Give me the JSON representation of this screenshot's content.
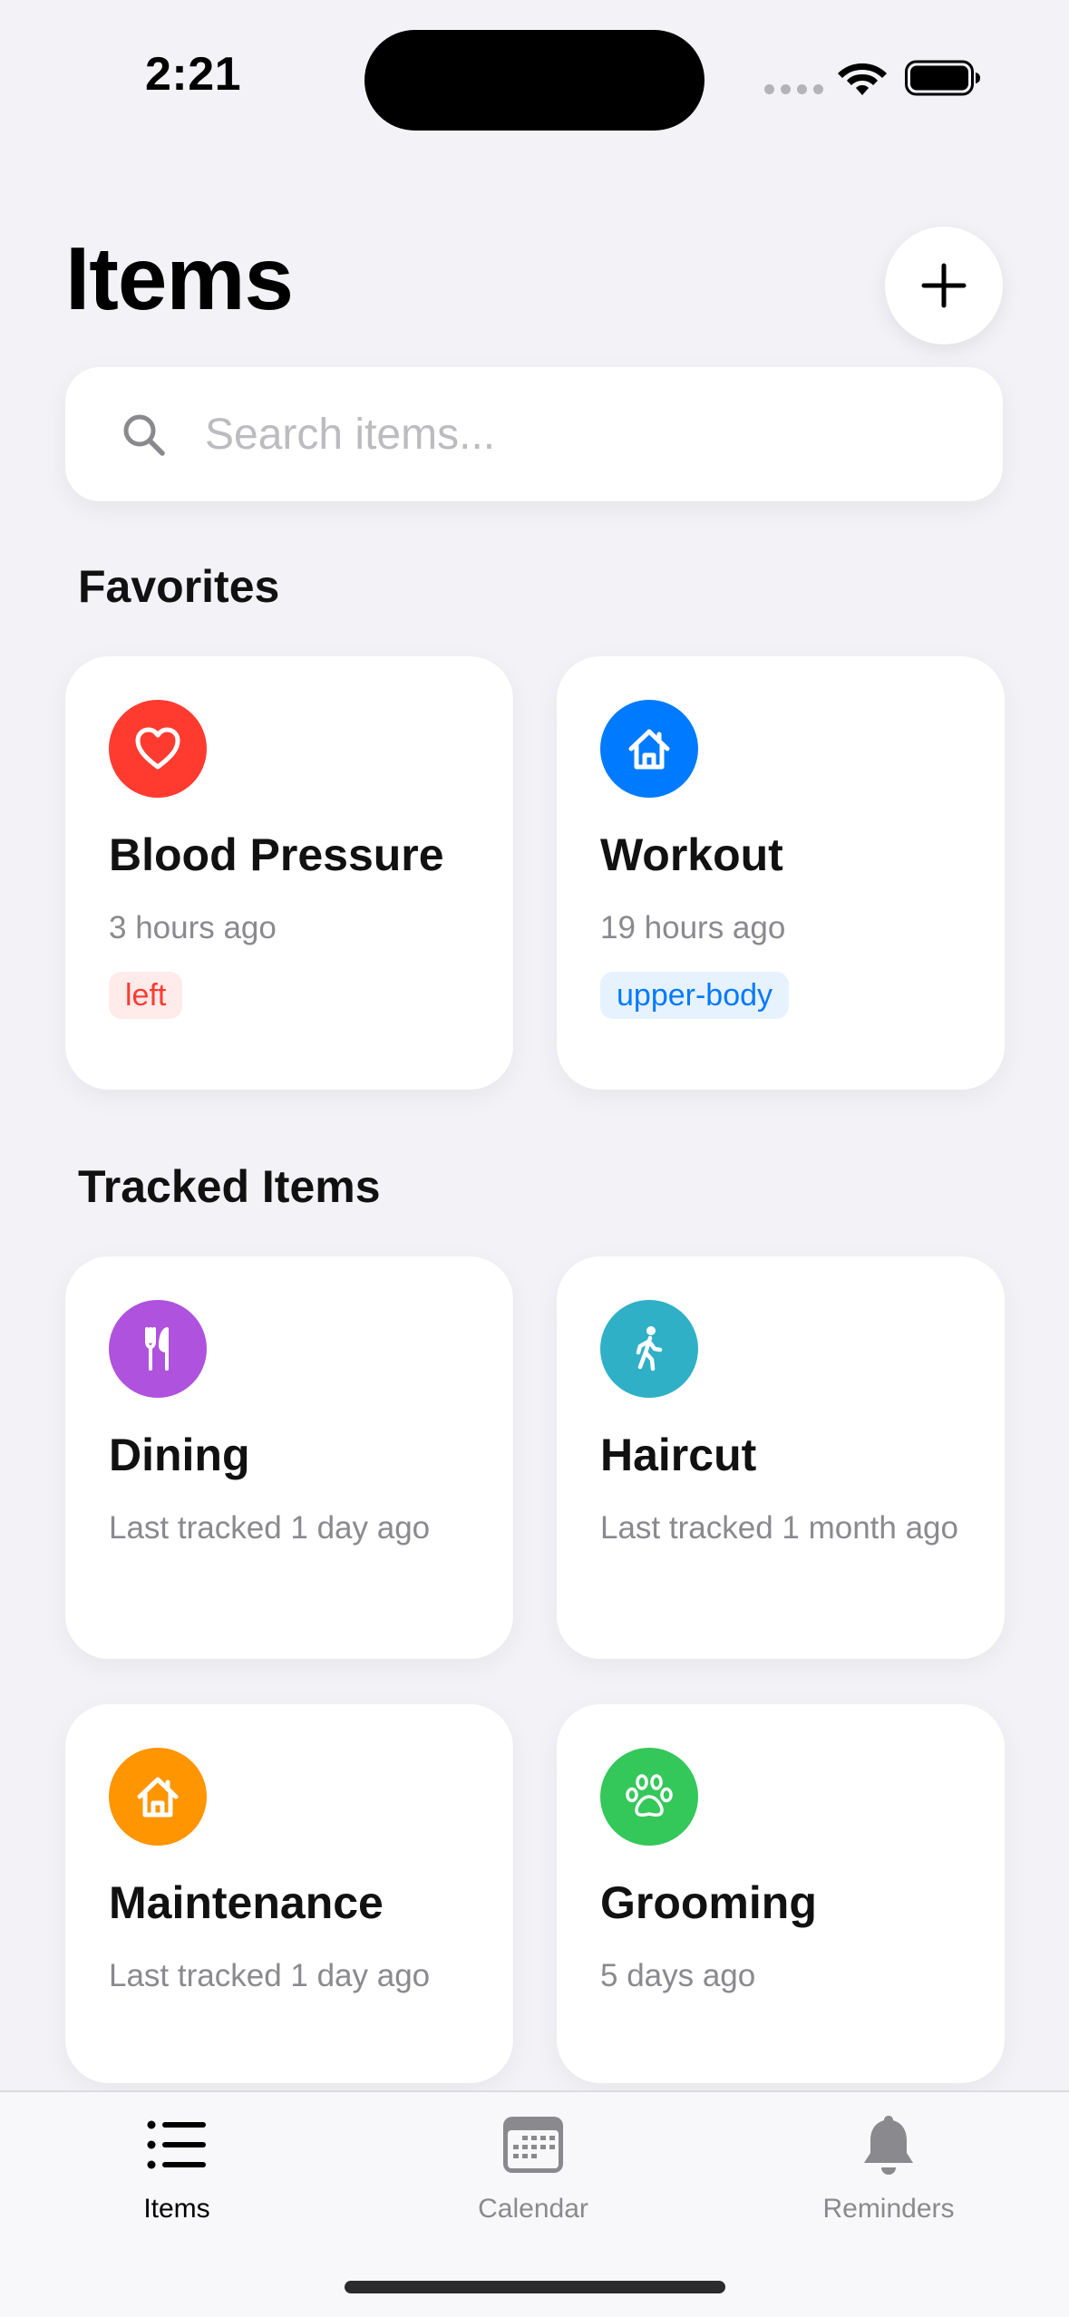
{
  "status_bar": {
    "time": "2:21"
  },
  "header": {
    "title": "Items",
    "add_icon": "plus-icon"
  },
  "search": {
    "placeholder": "Search items...",
    "value": ""
  },
  "favorites": {
    "title": "Favorites",
    "items": [
      {
        "title": "Blood Pressure",
        "subtitle": "3 hours ago",
        "tag": "left",
        "icon": "heart-icon",
        "color": "#ff3b30",
        "tag_color": "#ff3b30",
        "tag_bg": "#ffebea"
      },
      {
        "title": "Workout",
        "subtitle": "19 hours ago",
        "tag": "upper-body",
        "icon": "house-icon",
        "color": "#007aff",
        "tag_color": "#007aff",
        "tag_bg": "#e7f2ff"
      }
    ]
  },
  "tracked": {
    "title": "Tracked Items",
    "items": [
      {
        "title": "Dining",
        "subtitle": "Last tracked 1 day ago",
        "icon": "fork-knife-icon",
        "color": "#af52de"
      },
      {
        "title": "Haircut",
        "subtitle": "Last tracked 1 month ago",
        "icon": "person-walking-icon",
        "color": "#30b0c7"
      },
      {
        "title": "Maintenance",
        "subtitle": "Last tracked 1 day ago",
        "icon": "house-icon",
        "color": "#ff9500"
      },
      {
        "title": "Grooming",
        "subtitle": "5 days ago",
        "icon": "paw-icon",
        "color": "#34c759"
      }
    ]
  },
  "tab_bar": {
    "tabs": [
      {
        "label": "Items",
        "icon": "list-icon",
        "active": true
      },
      {
        "label": "Calendar",
        "icon": "calendar-icon",
        "active": false
      },
      {
        "label": "Reminders",
        "icon": "bell-icon",
        "active": false
      }
    ]
  },
  "colors": {
    "background": "#f2f2f7",
    "active_tab": "#000000",
    "inactive_tab": "#8a8a8e"
  }
}
